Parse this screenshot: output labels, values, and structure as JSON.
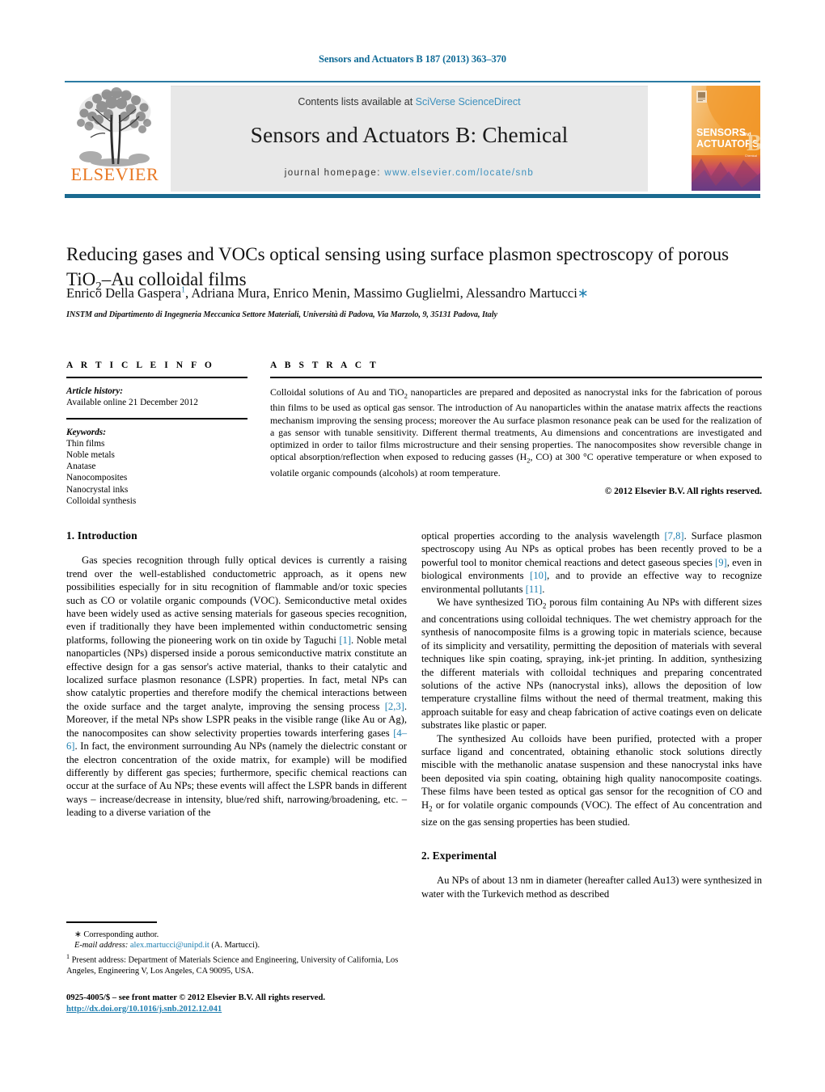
{
  "running_head": "Sensors and Actuators B 187 (2013) 363–370",
  "masthead": {
    "contents_prefix": "Contents lists available at",
    "contents_link": "SciVerse ScienceDirect",
    "journal_name": "Sensors and Actuators B: Chemical",
    "homepage_prefix": "journal homepage:",
    "homepage_url": "www.elsevier.com/locate/snb",
    "publisher": "ELSEVIER",
    "cover_line1": "SENSORS",
    "cover_and": "and",
    "cover_line2": "ACTUATORS",
    "cover_letter": "B",
    "accent_blue": "#3c90bd",
    "elsevier_orange": "#e87722",
    "rule_blue": "#1b6a90"
  },
  "article": {
    "title_part1": "Reducing gases and VOCs optical sensing using surface plasmon spectroscopy of porous TiO",
    "title_sub": "2",
    "title_part2": "–Au colloidal films",
    "authors": "Enrico Della Gaspera",
    "author_sup": "1",
    "authors_rest": ", Adriana Mura, Enrico Menin, Massimo Guglielmi, Alessandro Martucci",
    "author_star": "∗",
    "affiliation": "INSTM and Dipartimento di Ingegneria Meccanica Settore Materiali, Università di Padova, Via Marzolo, 9, 35131 Padova, Italy"
  },
  "article_info": {
    "heading": "A R T I C L E   I N F O",
    "history_label": "Article history:",
    "history_value": "Available online 21 December 2012",
    "keywords_label": "Keywords:",
    "keywords": [
      "Thin films",
      "Noble metals",
      "Anatase",
      "Nanocomposites",
      "Nanocrystal inks",
      "Colloidal synthesis"
    ]
  },
  "abstract": {
    "heading": "A B S T R A C T",
    "text_before_sub1": "Colloidal solutions of Au and TiO",
    "sub1": "2",
    "text_mid": " nanoparticles are prepared and deposited as nanocrystal inks for the fabrication of porous thin films to be used as optical gas sensor. The introduction of Au nanoparticles within the anatase matrix affects the reactions mechanism improving the sensing process; moreover the Au surface plasmon resonance peak can be used for the realization of a gas sensor with tunable sensitivity. Different thermal treatments, Au dimensions and concentrations are investigated and optimized in order to tailor films microstructure and their sensing properties. The nanocomposites show reversible change in optical absorption/reflection when exposed to reducing gasses (H",
    "sub2": "2",
    "text_after": ", CO) at 300 °C operative temperature or when exposed to volatile organic compounds (alcohols) at room temperature.",
    "copyright": "© 2012 Elsevier B.V. All rights reserved."
  },
  "sections": {
    "introduction_heading": "1.  Introduction",
    "experimental_heading": "2.  Experimental"
  },
  "body": {
    "left_p1_a": "Gas species recognition through fully optical devices is currently a raising trend over the well-established conductometric approach, as it opens new possibilities especially for in situ recognition of flammable and/or toxic species such as CO or volatile organic compounds (VOC). Semiconductive metal oxides have been widely used as active sensing materials for gaseous species recognition, even if traditionally they have been implemented within conductometric sensing platforms, following the pioneering work on tin oxide by Taguchi ",
    "ref1": "[1]",
    "left_p1_b": ". Noble metal nanoparticles (NPs) dispersed inside a porous semiconductive matrix constitute an effective design for a gas sensor's active material, thanks to their catalytic and localized surface plasmon resonance (LSPR) properties. In fact, metal NPs can show catalytic properties and therefore modify the chemical interactions between the oxide surface and the target analyte, improving the sensing process ",
    "ref2": "[2,3]",
    "left_p1_c": ". Moreover, if the metal NPs show LSPR peaks in the visible range (like Au or Ag), the nanocomposites can show selectivity properties towards interfering gases ",
    "ref3": "[4–6]",
    "left_p1_d": ". In fact, the environment surrounding Au NPs (namely the dielectric constant or the electron concentration of the oxide matrix, for example) will be modified differently by different gas species; furthermore, specific chemical reactions can occur at the surface of Au NPs; these events will affect the LSPR bands in different ways – increase/decrease in intensity, blue/red shift, narrowing/broadening, etc. – leading to a diverse variation of the",
    "right_p1_a": "optical properties according to the analysis wavelength ",
    "ref4": "[7,8]",
    "right_p1_b": ". Surface plasmon spectroscopy using Au NPs as optical probes has been recently proved to be a powerful tool to monitor chemical reactions and detect gaseous species ",
    "ref5": "[9]",
    "right_p1_c": ", even in biological environments ",
    "ref6": "[10]",
    "right_p1_d": ", and to provide an effective way to recognize environmental pollutants ",
    "ref7": "[11]",
    "right_p1_e": ".",
    "right_p2_a": "We have synthesized TiO",
    "right_p2_sub": "2",
    "right_p2_b": " porous film containing Au NPs with different sizes and concentrations using colloidal techniques. The wet chemistry approach for the synthesis of nanocomposite films is a growing topic in materials science, because of its simplicity and versatility, permitting the deposition of materials with several techniques like spin coating, spraying, ink-jet printing. In addition, synthesizing the different materials with colloidal techniques and preparing concentrated solutions of the active NPs (nanocrystal inks), allows the deposition of low temperature crystalline films without the need of thermal treatment, making this approach suitable for easy and cheap fabrication of active coatings even on delicate substrates like plastic or paper.",
    "right_p3_a": "The synthesized Au colloids have been purified, protected with a proper surface ligand and concentrated, obtaining ethanolic stock solutions directly miscible with the methanolic anatase suspension and these nanocrystal inks have been deposited via spin coating, obtaining high quality nanocomposite coatings. These films have been tested as optical gas sensor for the recognition of CO and H",
    "right_p3_sub": "2",
    "right_p3_b": " or for volatile organic compounds (VOC). The effect of Au concentration and size on the gas sensing properties has been studied.",
    "right_p4": "Au NPs of about 13 nm in diameter (hereafter called Au13) were synthesized in water with the Turkevich method as described"
  },
  "footnotes": {
    "corresponding_marker": "∗",
    "corresponding_text": "Corresponding author.",
    "email_label": "E-mail address:",
    "email": "alex.martucci@unipd.it",
    "email_attrib": "(A. Martucci).",
    "present_marker": "1",
    "present_text": "Present address: Department of Materials Science and Engineering, University of California, Los Angeles, Engineering V, Los Angeles, CA 90095, USA.",
    "frontmatter": "0925-4005/$ – see front matter © 2012 Elsevier B.V. All rights reserved.",
    "doi": "http://dx.doi.org/10.1016/j.snb.2012.12.041"
  }
}
